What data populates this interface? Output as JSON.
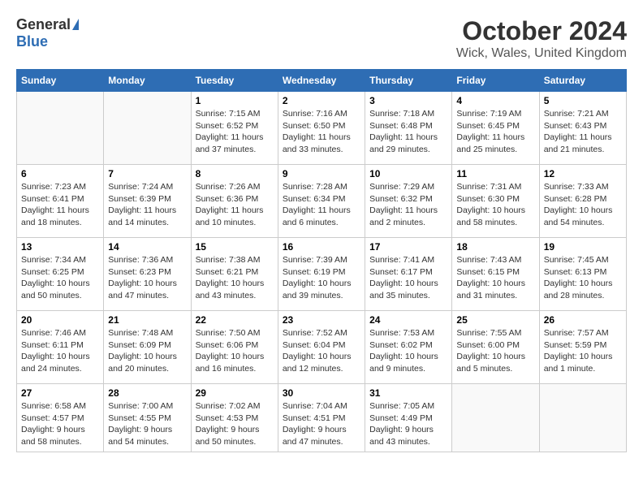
{
  "header": {
    "logo_general": "General",
    "logo_blue": "Blue",
    "month_title": "October 2024",
    "location": "Wick, Wales, United Kingdom"
  },
  "days_of_week": [
    "Sunday",
    "Monday",
    "Tuesday",
    "Wednesday",
    "Thursday",
    "Friday",
    "Saturday"
  ],
  "weeks": [
    [
      {
        "day": "",
        "sunrise": "",
        "sunset": "",
        "daylight": ""
      },
      {
        "day": "",
        "sunrise": "",
        "sunset": "",
        "daylight": ""
      },
      {
        "day": "1",
        "sunrise": "Sunrise: 7:15 AM",
        "sunset": "Sunset: 6:52 PM",
        "daylight": "Daylight: 11 hours and 37 minutes."
      },
      {
        "day": "2",
        "sunrise": "Sunrise: 7:16 AM",
        "sunset": "Sunset: 6:50 PM",
        "daylight": "Daylight: 11 hours and 33 minutes."
      },
      {
        "day": "3",
        "sunrise": "Sunrise: 7:18 AM",
        "sunset": "Sunset: 6:48 PM",
        "daylight": "Daylight: 11 hours and 29 minutes."
      },
      {
        "day": "4",
        "sunrise": "Sunrise: 7:19 AM",
        "sunset": "Sunset: 6:45 PM",
        "daylight": "Daylight: 11 hours and 25 minutes."
      },
      {
        "day": "5",
        "sunrise": "Sunrise: 7:21 AM",
        "sunset": "Sunset: 6:43 PM",
        "daylight": "Daylight: 11 hours and 21 minutes."
      }
    ],
    [
      {
        "day": "6",
        "sunrise": "Sunrise: 7:23 AM",
        "sunset": "Sunset: 6:41 PM",
        "daylight": "Daylight: 11 hours and 18 minutes."
      },
      {
        "day": "7",
        "sunrise": "Sunrise: 7:24 AM",
        "sunset": "Sunset: 6:39 PM",
        "daylight": "Daylight: 11 hours and 14 minutes."
      },
      {
        "day": "8",
        "sunrise": "Sunrise: 7:26 AM",
        "sunset": "Sunset: 6:36 PM",
        "daylight": "Daylight: 11 hours and 10 minutes."
      },
      {
        "day": "9",
        "sunrise": "Sunrise: 7:28 AM",
        "sunset": "Sunset: 6:34 PM",
        "daylight": "Daylight: 11 hours and 6 minutes."
      },
      {
        "day": "10",
        "sunrise": "Sunrise: 7:29 AM",
        "sunset": "Sunset: 6:32 PM",
        "daylight": "Daylight: 11 hours and 2 minutes."
      },
      {
        "day": "11",
        "sunrise": "Sunrise: 7:31 AM",
        "sunset": "Sunset: 6:30 PM",
        "daylight": "Daylight: 10 hours and 58 minutes."
      },
      {
        "day": "12",
        "sunrise": "Sunrise: 7:33 AM",
        "sunset": "Sunset: 6:28 PM",
        "daylight": "Daylight: 10 hours and 54 minutes."
      }
    ],
    [
      {
        "day": "13",
        "sunrise": "Sunrise: 7:34 AM",
        "sunset": "Sunset: 6:25 PM",
        "daylight": "Daylight: 10 hours and 50 minutes."
      },
      {
        "day": "14",
        "sunrise": "Sunrise: 7:36 AM",
        "sunset": "Sunset: 6:23 PM",
        "daylight": "Daylight: 10 hours and 47 minutes."
      },
      {
        "day": "15",
        "sunrise": "Sunrise: 7:38 AM",
        "sunset": "Sunset: 6:21 PM",
        "daylight": "Daylight: 10 hours and 43 minutes."
      },
      {
        "day": "16",
        "sunrise": "Sunrise: 7:39 AM",
        "sunset": "Sunset: 6:19 PM",
        "daylight": "Daylight: 10 hours and 39 minutes."
      },
      {
        "day": "17",
        "sunrise": "Sunrise: 7:41 AM",
        "sunset": "Sunset: 6:17 PM",
        "daylight": "Daylight: 10 hours and 35 minutes."
      },
      {
        "day": "18",
        "sunrise": "Sunrise: 7:43 AM",
        "sunset": "Sunset: 6:15 PM",
        "daylight": "Daylight: 10 hours and 31 minutes."
      },
      {
        "day": "19",
        "sunrise": "Sunrise: 7:45 AM",
        "sunset": "Sunset: 6:13 PM",
        "daylight": "Daylight: 10 hours and 28 minutes."
      }
    ],
    [
      {
        "day": "20",
        "sunrise": "Sunrise: 7:46 AM",
        "sunset": "Sunset: 6:11 PM",
        "daylight": "Daylight: 10 hours and 24 minutes."
      },
      {
        "day": "21",
        "sunrise": "Sunrise: 7:48 AM",
        "sunset": "Sunset: 6:09 PM",
        "daylight": "Daylight: 10 hours and 20 minutes."
      },
      {
        "day": "22",
        "sunrise": "Sunrise: 7:50 AM",
        "sunset": "Sunset: 6:06 PM",
        "daylight": "Daylight: 10 hours and 16 minutes."
      },
      {
        "day": "23",
        "sunrise": "Sunrise: 7:52 AM",
        "sunset": "Sunset: 6:04 PM",
        "daylight": "Daylight: 10 hours and 12 minutes."
      },
      {
        "day": "24",
        "sunrise": "Sunrise: 7:53 AM",
        "sunset": "Sunset: 6:02 PM",
        "daylight": "Daylight: 10 hours and 9 minutes."
      },
      {
        "day": "25",
        "sunrise": "Sunrise: 7:55 AM",
        "sunset": "Sunset: 6:00 PM",
        "daylight": "Daylight: 10 hours and 5 minutes."
      },
      {
        "day": "26",
        "sunrise": "Sunrise: 7:57 AM",
        "sunset": "Sunset: 5:59 PM",
        "daylight": "Daylight: 10 hours and 1 minute."
      }
    ],
    [
      {
        "day": "27",
        "sunrise": "Sunrise: 6:58 AM",
        "sunset": "Sunset: 4:57 PM",
        "daylight": "Daylight: 9 hours and 58 minutes."
      },
      {
        "day": "28",
        "sunrise": "Sunrise: 7:00 AM",
        "sunset": "Sunset: 4:55 PM",
        "daylight": "Daylight: 9 hours and 54 minutes."
      },
      {
        "day": "29",
        "sunrise": "Sunrise: 7:02 AM",
        "sunset": "Sunset: 4:53 PM",
        "daylight": "Daylight: 9 hours and 50 minutes."
      },
      {
        "day": "30",
        "sunrise": "Sunrise: 7:04 AM",
        "sunset": "Sunset: 4:51 PM",
        "daylight": "Daylight: 9 hours and 47 minutes."
      },
      {
        "day": "31",
        "sunrise": "Sunrise: 7:05 AM",
        "sunset": "Sunset: 4:49 PM",
        "daylight": "Daylight: 9 hours and 43 minutes."
      },
      {
        "day": "",
        "sunrise": "",
        "sunset": "",
        "daylight": ""
      },
      {
        "day": "",
        "sunrise": "",
        "sunset": "",
        "daylight": ""
      }
    ]
  ]
}
